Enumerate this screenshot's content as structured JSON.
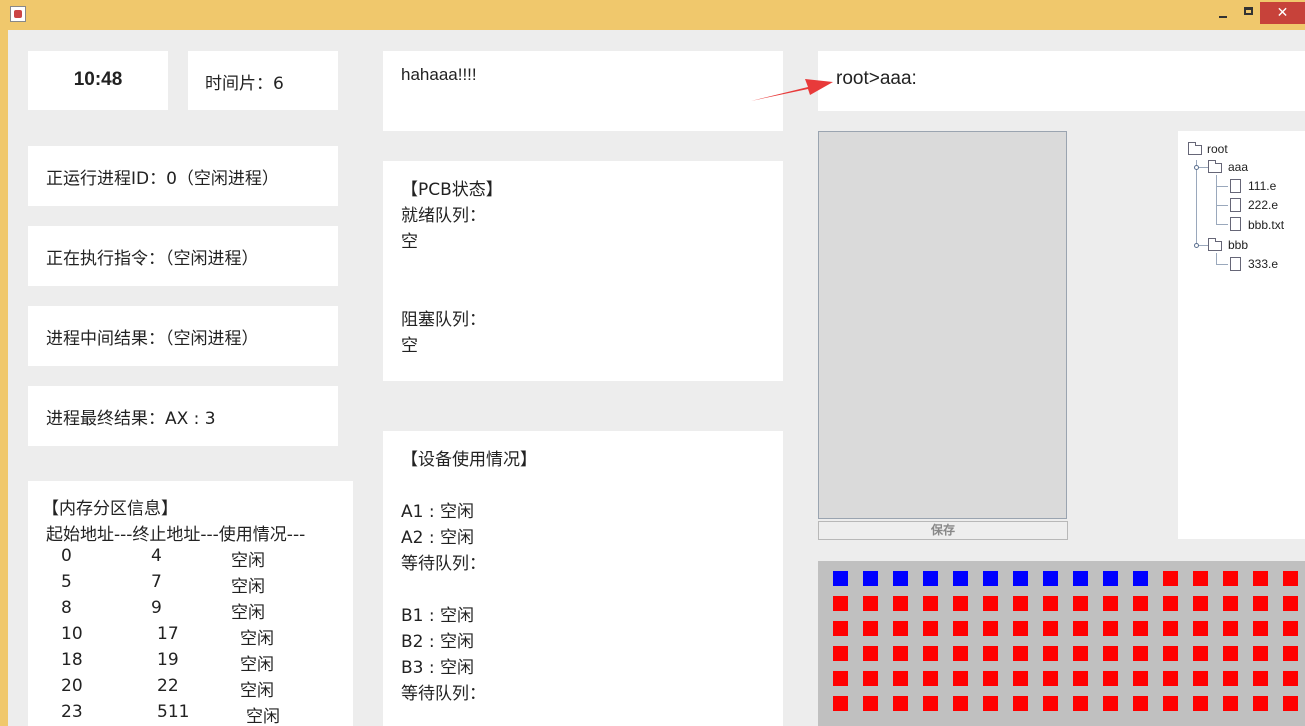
{
  "window": {
    "close_glyph": "✕"
  },
  "clock": "10:48",
  "time_slice": "时间片：6",
  "running_process": "正运行进程ID：0（空闲进程）",
  "executing_instruction": "正在执行指令：（空闲进程）",
  "intermediate_result": "进程中间结果：（空闲进程）",
  "final_result": "进程最终结果：AX : 3",
  "memory": {
    "title": "【内存分区信息】",
    "header": "起始地址---终止地址---使用情况---",
    "rows": [
      {
        "start": "0",
        "end": "4",
        "status": "空闲"
      },
      {
        "start": "5",
        "end": "7",
        "status": "空闲"
      },
      {
        "start": "8",
        "end": "9",
        "status": "空闲"
      },
      {
        "start": "10",
        "end": "17",
        "status": "空闲"
      },
      {
        "start": "18",
        "end": "19",
        "status": "空闲"
      },
      {
        "start": "20",
        "end": "22",
        "status": "空闲"
      },
      {
        "start": "23",
        "end": "511",
        "status": "空闲"
      }
    ]
  },
  "message": "hahaaa!!!!",
  "pcb": {
    "title": "【PCB状态】",
    "ready_label": "就绪队列：",
    "ready_value": "空",
    "blocked_label": "阻塞队列：",
    "blocked_value": "空"
  },
  "devices": {
    "title": "【设备使用情况】",
    "a1": "A1 : 空闲",
    "a2": "A2 : 空闲",
    "a_wait": "等待队列：",
    "b1": "B1 : 空闲",
    "b2": "B2 : 空闲",
    "b3": "B3 : 空闲",
    "b_wait": "等待队列："
  },
  "command_prompt": "root>aaa:",
  "save_button": "保存",
  "tree": {
    "root": "root",
    "aaa": "aaa",
    "aaa_files": [
      "111.e",
      "222.e",
      "bbb.txt"
    ],
    "bbb": "bbb",
    "bbb_files": [
      "333.e"
    ]
  },
  "colors": {
    "used_block": "#0000ff",
    "free_block": "#ff0000",
    "arrow": "#e83a3a"
  },
  "disk_blocks": {
    "columns": 16,
    "rows": 6,
    "used_count": 11
  }
}
